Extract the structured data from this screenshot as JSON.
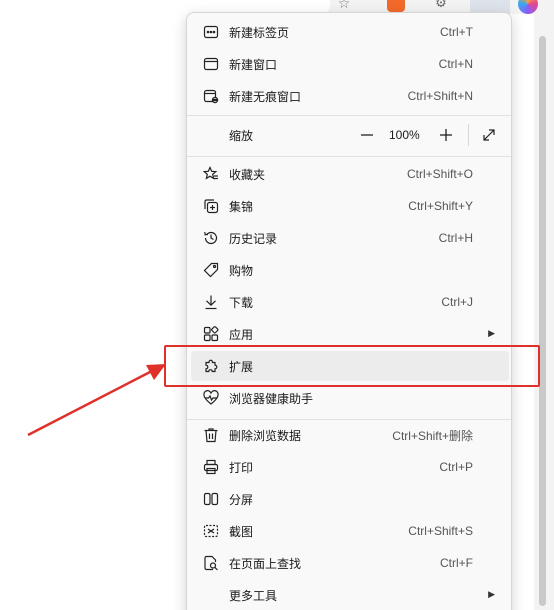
{
  "menu": {
    "new_tab": {
      "label": "新建标签页",
      "shortcut": "Ctrl+T",
      "icon": "new-tab-icon"
    },
    "new_window": {
      "label": "新建窗口",
      "shortcut": "Ctrl+N",
      "icon": "new-window-icon"
    },
    "new_inprivate": {
      "label": "新建无痕窗口",
      "shortcut": "Ctrl+Shift+N",
      "icon": "inprivate-window-icon"
    },
    "zoom": {
      "label": "缩放",
      "value": "100%"
    },
    "favorites": {
      "label": "收藏夹",
      "shortcut": "Ctrl+Shift+O",
      "icon": "star-icon"
    },
    "collections": {
      "label": "集锦",
      "shortcut": "Ctrl+Shift+Y",
      "icon": "collections-icon"
    },
    "history": {
      "label": "历史记录",
      "shortcut": "Ctrl+H",
      "icon": "history-icon"
    },
    "shopping": {
      "label": "购物",
      "icon": "tag-icon"
    },
    "downloads": {
      "label": "下载",
      "shortcut": "Ctrl+J",
      "icon": "download-icon"
    },
    "apps": {
      "label": "应用",
      "icon": "apps-icon"
    },
    "extensions": {
      "label": "扩展",
      "icon": "puzzle-icon"
    },
    "browser_health": {
      "label": "浏览器健康助手",
      "icon": "heartbeat-icon"
    },
    "clear_data": {
      "label": "删除浏览数据",
      "shortcut": "Ctrl+Shift+删除",
      "icon": "trash-icon"
    },
    "print": {
      "label": "打印",
      "shortcut": "Ctrl+P",
      "icon": "print-icon"
    },
    "split_screen": {
      "label": "分屏",
      "icon": "split-screen-icon"
    },
    "screenshot": {
      "label": "截图",
      "shortcut": "Ctrl+Shift+S",
      "icon": "screenshot-icon"
    },
    "find": {
      "label": "在页面上查找",
      "shortcut": "Ctrl+F",
      "icon": "find-icon"
    },
    "more_tools": {
      "label": "更多工具",
      "icon": "more-tools-icon"
    }
  },
  "colors": {
    "menu_bg": "#f9f9f9",
    "highlight_bg": "#ececec",
    "annotation_red": "#e0302a"
  }
}
